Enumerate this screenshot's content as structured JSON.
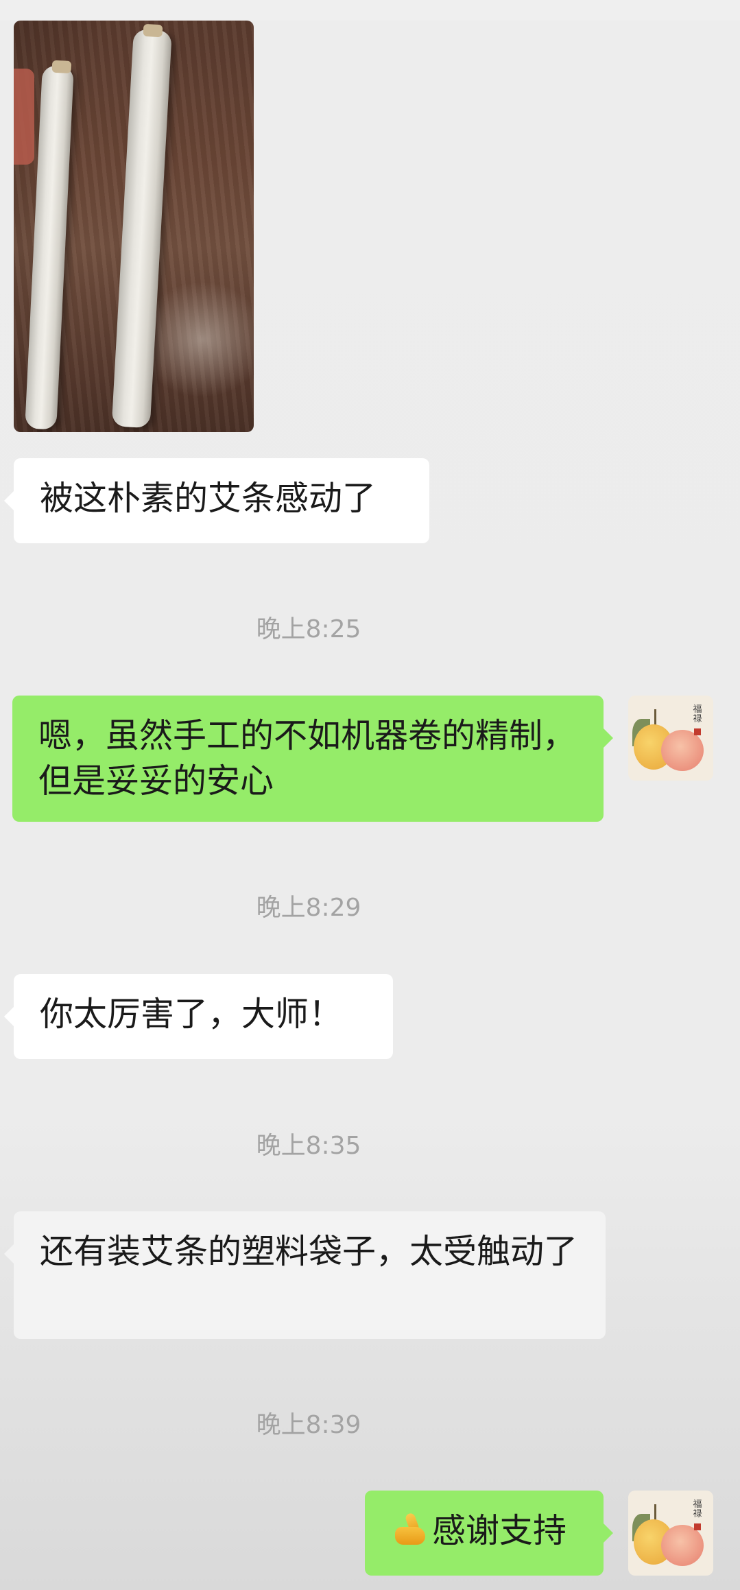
{
  "messages": {
    "m1_text": "被这朴素的艾条感动了",
    "t1": "晚上8:25",
    "m2_text": "嗯，虽然手工的不如机器卷的精制，但是妥妥的安心",
    "t2": "晚上8:29",
    "m3_text": "你太厉害了，大师！",
    "t3": "晚上8:35",
    "m4_text": "还有装艾条的塑料袋子，太受触动了",
    "t4": "晚上8:39",
    "m5_text": "感谢支持"
  },
  "avatar": {
    "seal_text": "福禄"
  },
  "icons": {
    "emoji": "thumbs-up-icon",
    "avatar": "fruit-painting-avatar"
  },
  "colors": {
    "background": "#ededed",
    "outgoing_bubble": "#95ec69",
    "incoming_bubble": "#ffffff",
    "timestamp": "#a3a3a3"
  }
}
